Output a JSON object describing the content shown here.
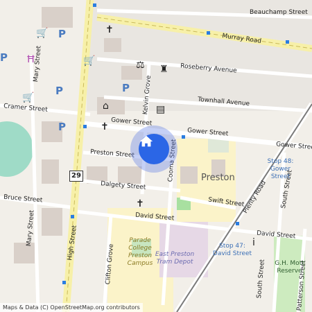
{
  "map": {
    "streets": [
      "Beauchamp Street",
      "Murray Road",
      "Roseberry Avenue",
      "Townhall Avenue",
      "Cramer Street",
      "Gower Street",
      "Gower Street",
      "Gower Street",
      "Preston Street",
      "Dalgety Street",
      "Bruce Street",
      "Swift Street",
      "David Street",
      "David Street",
      "Mary Street",
      "Mary Street",
      "High Street",
      "Kelvin Grove",
      "Cooma Street",
      "Plenty Road",
      "South Street",
      "South Street",
      "Clifton Grove",
      "Patterson Street"
    ],
    "route_shield": "29",
    "suburb": "Preston",
    "stops": [
      "Stop 48: Gower Street",
      "Stop 47: David Street"
    ],
    "campus": "Parade College Preston Campus",
    "depot": "East Preston Tram Depot",
    "reserve": "G.H. Mott Reserve",
    "attribution": "Maps & Data (C) OpenStreetMap.org contributors"
  },
  "home_button": {
    "icon": "home-icon"
  },
  "colors": {
    "accent": "#2b66e6",
    "road_major": "#f7f0a8",
    "campus": "#fbf3c9",
    "park": "#cdebbf"
  }
}
